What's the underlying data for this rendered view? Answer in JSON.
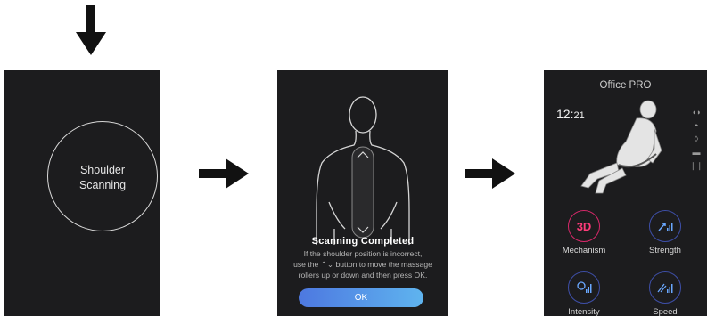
{
  "panel1": {
    "circle_text_line1": "Shoulder",
    "circle_text_line2": "Scanning"
  },
  "panel2": {
    "title": "Scanning  Completed",
    "body_line1": "If the shoulder position is incorrect,",
    "body_line2": "use the ⌃⌄ button to move the massage",
    "body_line3": "rollers up or down and then press OK.",
    "ok_label": "OK"
  },
  "panel3": {
    "title": "Office PRO",
    "time_hour": "12:",
    "time_min": "21",
    "controls": [
      {
        "label": "Mechanism",
        "icon": "3D"
      },
      {
        "label": "Strength",
        "icon": "strength-icon"
      },
      {
        "label": "Intensity",
        "icon": "intensity-icon"
      },
      {
        "label": "Speed",
        "icon": "speed-icon"
      }
    ]
  },
  "colors": {
    "panel_bg": "#1c1c1e",
    "accent_pink": "#d8286a",
    "accent_blue": "#3e4fa8",
    "button_gradient": [
      "#4d78e0",
      "#5fb4ef"
    ]
  }
}
